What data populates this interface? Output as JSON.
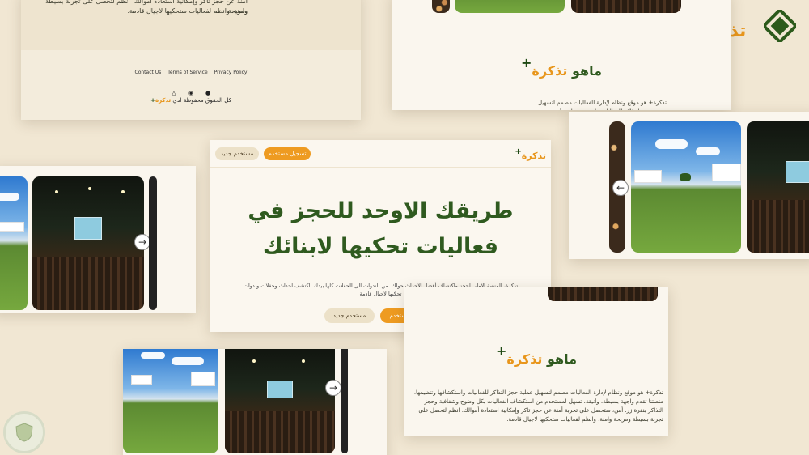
{
  "brand": {
    "name": "تذكرة",
    "plus": "+"
  },
  "hero": {
    "login_button": "تسجيل مستخدم",
    "new_user_button": "مستخدم جديد",
    "headline_line1": "طريقك الاوحد للحجز في",
    "headline_line2": "فعاليات تحكيها لابنائك",
    "description": "تذكرة، المنصة الاولى لحجز واكتشاف أفضل الاحداث حولك. من الندوات الى الحفلات كلها بيدك. اكتشف احداث وحفلات وندوات تحكيها لاجيال قادمة",
    "cta_login": "تسجيل مستخدم",
    "cta_new_user": "مستخدم جديد"
  },
  "footer": {
    "top_text_1": "أمنة عن حجز تاكر وإمكانية استعادة أموالك. انظم لتحصل على تجربة بسيطة ومريحة",
    "top_text_2": "وامنة، وانظم لفعاليات ستحكيها لاجيال قادمة.",
    "links": [
      "Contact Us",
      "Terms of Service",
      "Privacy Policy"
    ],
    "social_icons": [
      "twitter-icon",
      "instagram-icon",
      "facebook-icon"
    ],
    "copyright_prefix": "كل الحقوق محفوظة لدي",
    "copyright_brand": "تذكرة"
  },
  "about": {
    "title_prefix": "ماهو",
    "title_brand": "تذكرة",
    "body_full": "تذكرة+ هو موقع ونظام لإدارة الفعاليات مصمم لتسهيل عملية حجز التذاكر للفعاليات واستكشافها وتنظيمها. منصتنا تقدم واجهة بسيطة، وأنيقة، تسهل لمستخدم من استكشاف الفعاليات بكل وضوح وشفافية وحجز التذاكر بنقرة زر. أمن، ستحصل على تجربة أمنة عن حجز تاكر وإمكانية استعادة أموالك. انظم لتحصل على تجربة بسيطة ومريحة وامنة، وانظم لفعاليات ستحكيها لاجيال قادمة.",
    "body_partial": "تذكرة+ هو موقع ونظام لإدارة الفعاليات مصمم لتسهيل عملية حجز التذاكر للفعاليات واجهة بسيطة، وأنيقة، تسهل لمستخدم من وحجز التذاكر بنقرة زر. أمن، ستحصل على تجربة أموالك. انظم لتحصل على تجربة بسيطة ومريحة"
  },
  "carousel": {
    "next_arrow": "→",
    "prev_arrow": "←"
  },
  "colors": {
    "accent": "#ee9b21",
    "brand_green": "#2f5a1f",
    "background": "#f1e7d3"
  }
}
